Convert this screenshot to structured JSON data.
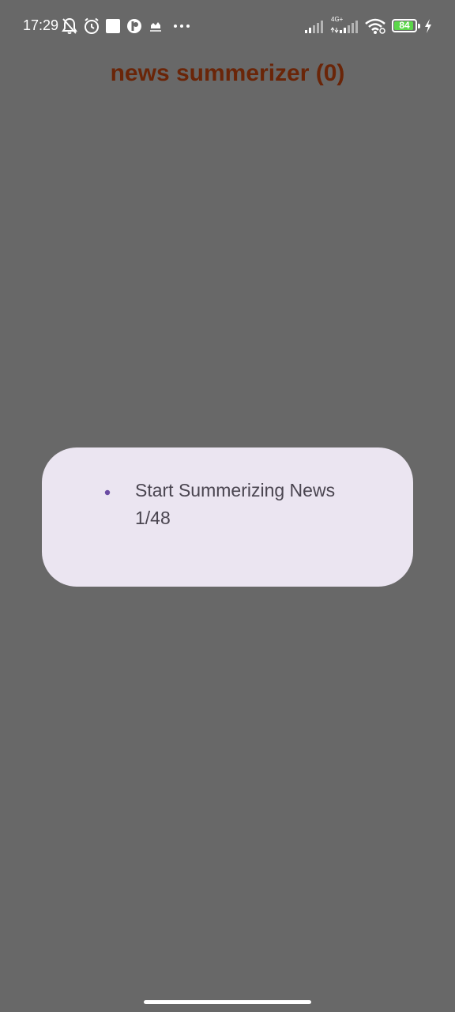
{
  "status_bar": {
    "time": "17:29",
    "battery_level": "84",
    "network_label": "4G+",
    "icons": [
      "bell-off-icon",
      "alarm-icon",
      "square-notification-icon",
      "app-notification-icon",
      "cloud-icon",
      "more-dots-icon",
      "signal-icon",
      "signal-4g-icon",
      "wifi-icon",
      "battery-icon",
      "charging-icon"
    ]
  },
  "header": {
    "title": "news summerizer (0)"
  },
  "dialog": {
    "message": "Start Summerizing News 1/48"
  },
  "colors": {
    "background": "#686868",
    "title": "#6a2508",
    "dialog_bg": "#ebe5f1",
    "dialog_text": "#4a4550",
    "spinner": "#6a4ba3",
    "battery_fill": "#5cd64a"
  }
}
